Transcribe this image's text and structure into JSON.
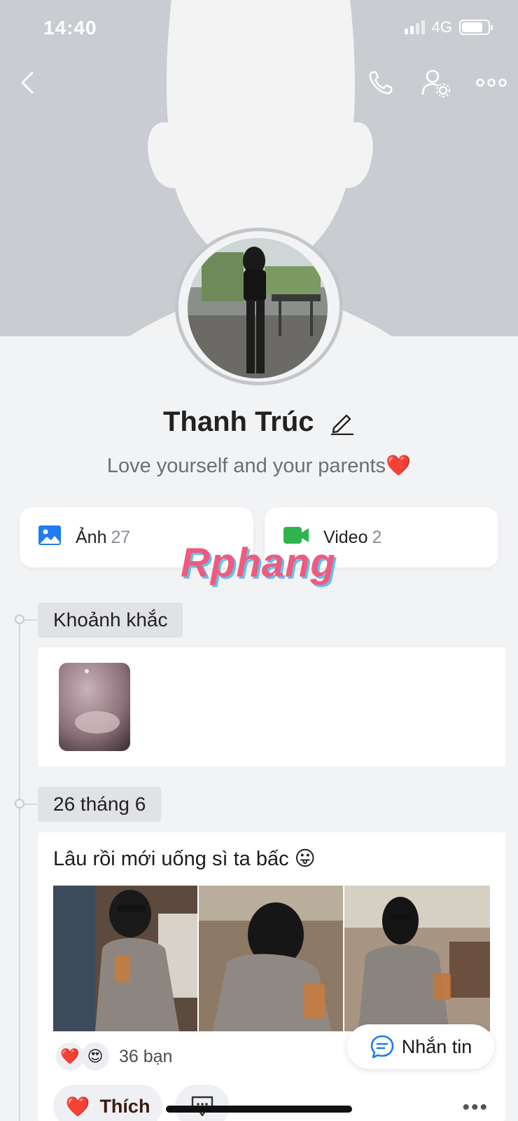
{
  "status_bar": {
    "time": "14:40",
    "network": "4G",
    "battery_level": 0.8
  },
  "nav": {
    "back_icon": "chevron-left-icon",
    "call_icon": "phone-icon",
    "settings_icon": "user-settings-icon",
    "more_icon": "more-horizontal-icon"
  },
  "profile": {
    "name": "Thanh Trúc",
    "bio": "Love yourself and your parents❤️"
  },
  "media": {
    "photos_label": "Ảnh",
    "photos_count": "27",
    "videos_label": "Video",
    "videos_count": "2"
  },
  "watermark": "Rphang",
  "timeline": {
    "moments_label": "Khoảnh khắc",
    "date_label": "26 tháng 6",
    "post_text": "Lâu rồi mới uống sì ta bấc 😛",
    "reactions": {
      "emoji_1": "❤️",
      "emoji_2": "😍",
      "count": "36 bạn"
    },
    "like_icon": "❤️",
    "like_label": "Thích",
    "more_label": "•••"
  },
  "message_button": {
    "label": "Nhắn tin"
  },
  "colors": {
    "accent_blue": "#1f7cf2",
    "video_green": "#2fb34f",
    "cover_gray": "#c9ccd1",
    "watermark_pink": "#f05a7e",
    "watermark_blue": "#5ec2ee"
  }
}
